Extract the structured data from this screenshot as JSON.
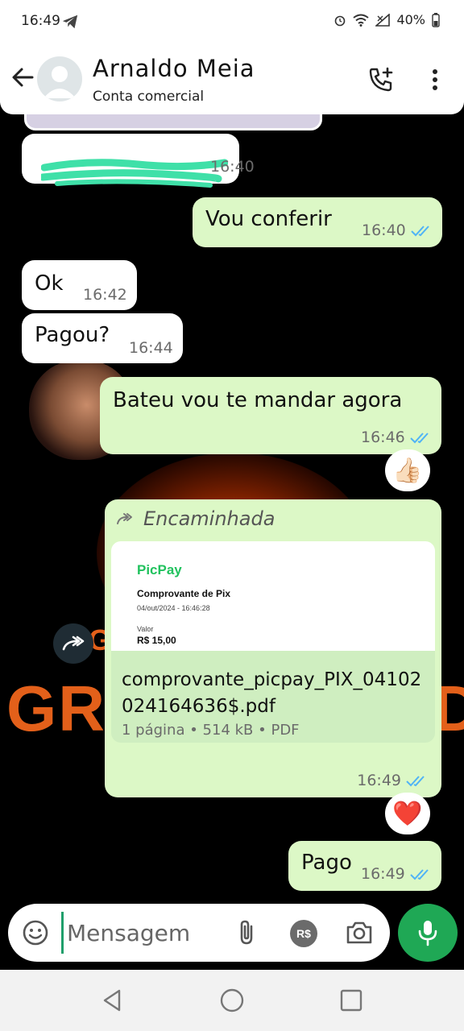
{
  "status_bar": {
    "time": "16:49",
    "battery": "40%"
  },
  "header": {
    "contact_name": "Arnaldo Meia",
    "subtitle": "Conta comercial"
  },
  "messages": [
    {
      "id": "m1",
      "direction": "in",
      "text": "",
      "time": "16:40",
      "redacted": true
    },
    {
      "id": "m2",
      "direction": "out",
      "text": "Vou conferir",
      "time": "16:40",
      "read": true
    },
    {
      "id": "m3",
      "direction": "in",
      "text": "Ok",
      "time": "16:42"
    },
    {
      "id": "m4",
      "direction": "in",
      "text": "Pagou?",
      "time": "16:44"
    },
    {
      "id": "m5",
      "direction": "out",
      "text": "Bateu vou te mandar agora",
      "time": "16:46",
      "read": true,
      "reaction": "👍🏻"
    },
    {
      "id": "m6",
      "direction": "out",
      "forwarded_label": "Encaminhada",
      "time": "16:49",
      "read": true,
      "reaction": "❤️",
      "document": {
        "preview": {
          "brand": "PicPay",
          "title": "Comprovante de Pix",
          "date": "04/out/2024 - 16:46:28",
          "value_label": "Valor",
          "value": "R$ 15,00"
        },
        "file_name": "comprovante_picpay_PIX_04102024164636$.pdf",
        "file_info": "1 página • 514 kB • PDF"
      }
    },
    {
      "id": "m7",
      "direction": "out",
      "text": "Pago",
      "time": "16:49",
      "read": true
    }
  ],
  "wallpaper": {
    "text_left": "GRU",
    "text_right": "D",
    "text_small": "G"
  },
  "composer": {
    "placeholder": "Mensagem",
    "pay_label": "R$"
  },
  "colors": {
    "outgoing_bubble": "#dcf8c6",
    "incoming_bubble": "#ffffff",
    "read_ticks": "#4fb3f6",
    "mic_button": "#1fa855"
  }
}
